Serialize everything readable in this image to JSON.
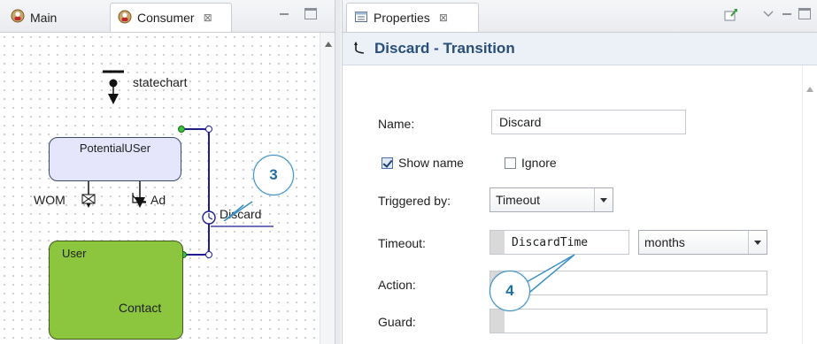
{
  "left": {
    "tabs": [
      {
        "label": "Main"
      },
      {
        "label": "Consumer",
        "close": "⊠"
      }
    ]
  },
  "diagram": {
    "statechart_label": "statechart",
    "states": {
      "potential": "PotentialUSer",
      "user": "User"
    },
    "transitions": {
      "wom": "WOM",
      "ad": "Ad",
      "discard": "Discard",
      "contact": "Contact"
    },
    "callouts": [
      "3",
      "4"
    ]
  },
  "right": {
    "tab_label": "Properties",
    "tab_close": "⊠",
    "header_title": "Discard - Transition",
    "fields": {
      "name_label": "Name:",
      "name_value": "Discard",
      "show_name_label": "Show name",
      "show_name_checked": true,
      "ignore_label": "Ignore",
      "ignore_checked": false,
      "triggered_label": "Triggered by:",
      "triggered_value": "Timeout",
      "timeout_label": "Timeout:",
      "timeout_value": "DiscardTime",
      "timeout_unit": "months",
      "action_label": "Action:",
      "action_value": "",
      "guard_label": "Guard:",
      "guard_value": ""
    }
  },
  "colors": {
    "potential_state": "#e5e6fb",
    "user_state": "#8cc63f",
    "callout_border": "#3a8fc4",
    "title": "#2a4e7a"
  }
}
